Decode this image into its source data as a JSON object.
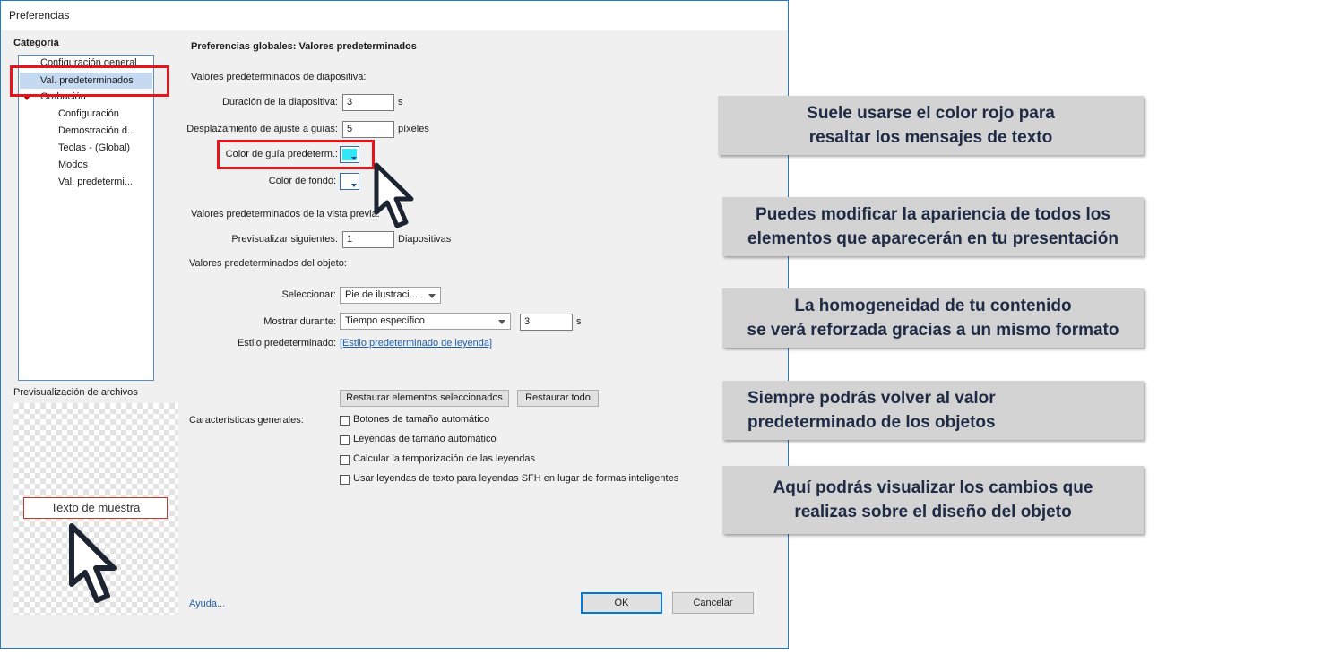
{
  "window": {
    "title": "Preferencias"
  },
  "sidebar": {
    "header": "Categoría",
    "items": [
      {
        "label": "Configuración general"
      },
      {
        "label": "Val. predeterminados"
      },
      {
        "label": "Grabación"
      },
      {
        "label": "Configuración"
      },
      {
        "label": "Demostración d..."
      },
      {
        "label": "Teclas - (Global)"
      },
      {
        "label": "Modos"
      },
      {
        "label": "Val. predetermi..."
      }
    ]
  },
  "preview": {
    "label": "Previsualización de archivos",
    "sample_text": "Texto de muestra"
  },
  "main": {
    "title": "Preferencias globales: Valores predeterminados",
    "slide_section": "Valores predeterminados de diapositiva:",
    "slide_duration": {
      "label": "Duración de la diapositiva:",
      "value": "3",
      "unit": "s"
    },
    "snap_offset": {
      "label": "Desplazamiento de ajuste a guías:",
      "value": "5",
      "unit": "píxeles"
    },
    "guide_color": {
      "label": "Color de guía predeterm.:",
      "color": "#33e6f5"
    },
    "bg_color": {
      "label": "Color de fondo:",
      "color": "#ffffff"
    },
    "preview_section": "Valores predeterminados de la vista previa:",
    "preview_next": {
      "label": "Previsualizar siguientes:",
      "value": "1",
      "unit": "Diapositivas"
    },
    "object_section": "Valores predeterminados del objeto:",
    "select": {
      "label": "Seleccionar:",
      "value": "Pie de ilustraci..."
    },
    "show_for": {
      "label": "Mostrar durante:",
      "value": "Tiempo específico",
      "time_value": "3",
      "unit": "s"
    },
    "default_style": {
      "label": "Estilo predeterminado:",
      "link": "[Estilo predeterminado de leyenda]"
    },
    "restore_selected": "Restaurar elementos seleccionados",
    "restore_all": "Restaurar todo",
    "general_label": "Características generales:",
    "checkboxes": [
      {
        "label": "Botones de tamaño automático"
      },
      {
        "label": "Leyendas de tamaño automático"
      },
      {
        "label": "Calcular la temporización de las leyendas"
      },
      {
        "label": "Usar leyendas de texto para leyendas SFH en lugar de formas inteligentes"
      }
    ],
    "help_link": "Ayuda...",
    "ok": "OK",
    "cancel": "Cancelar"
  },
  "callouts": [
    {
      "line1": "Suele usarse el color rojo para",
      "line2": "resaltar los mensajes de texto"
    },
    {
      "line1": "Puedes modificar la apariencia de todos los",
      "line2": "elementos que aparecerán en tu presentación"
    },
    {
      "line1": "La homogeneidad de tu contenido",
      "line2": "se verá reforzada gracias a un mismo formato"
    },
    {
      "line1": "Siempre podrás volver al valor",
      "line2": "predeterminado de los objetos"
    },
    {
      "line1": "Aquí podrás visualizar los cambios que",
      "line2": "realizas sobre el diseño del objeto"
    }
  ],
  "colors": {
    "highlight": "#e8141c",
    "callout_bg": "#d3d3d3",
    "callout_text": "#1f2a44",
    "accent": "#2b78c5"
  }
}
